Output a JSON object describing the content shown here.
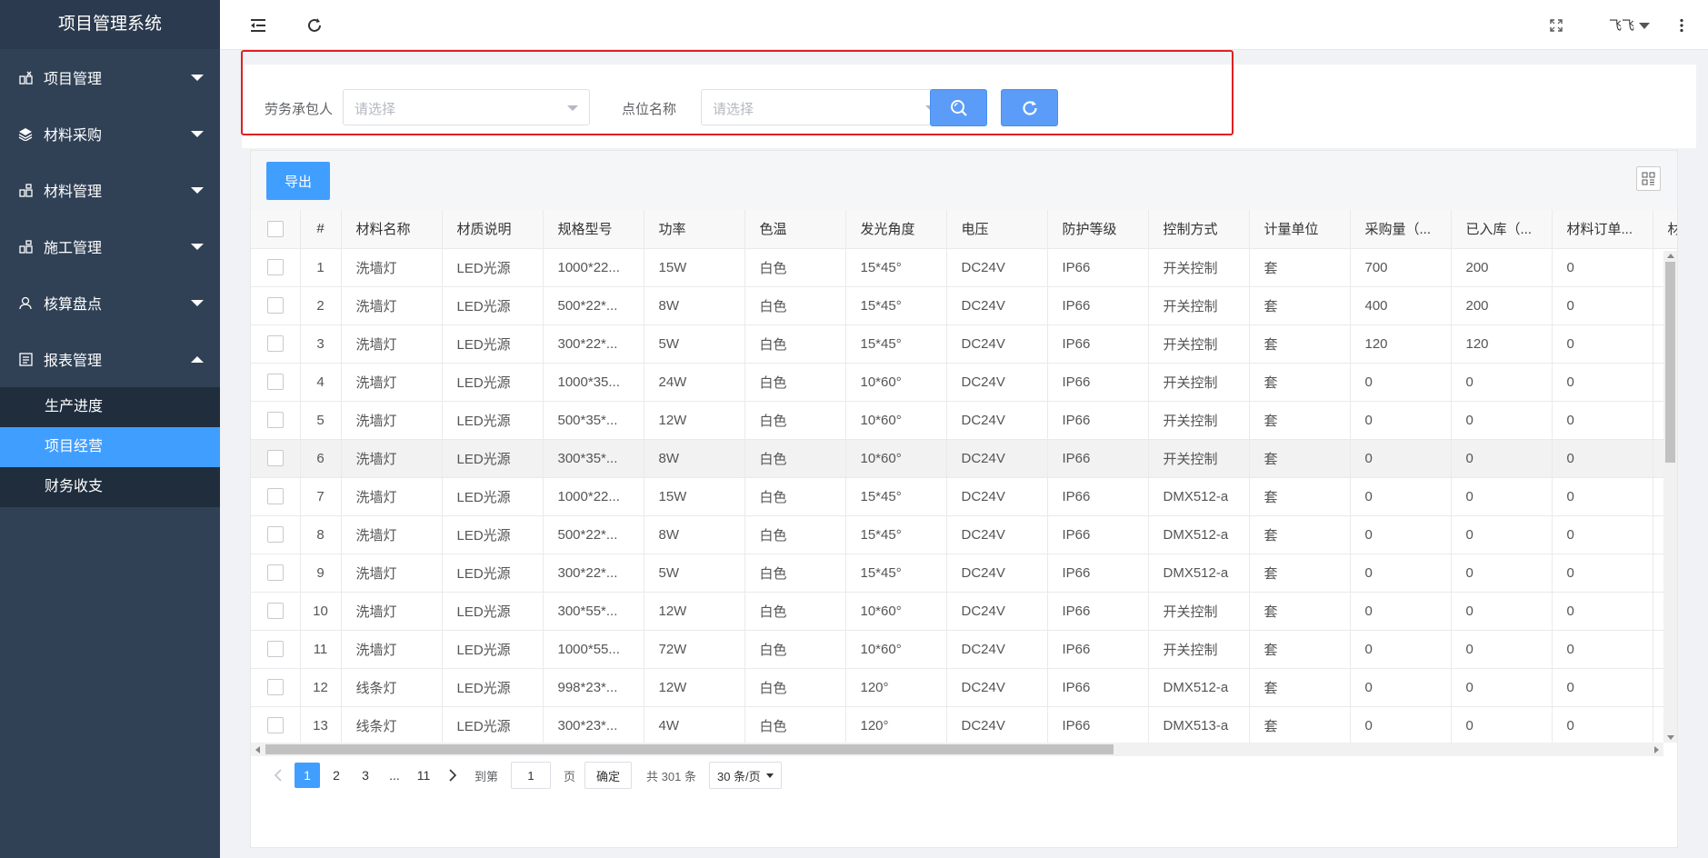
{
  "app": {
    "title": "项目管理系统"
  },
  "sidebar": {
    "menus": [
      {
        "label": "项目管理",
        "icon": "project-icon",
        "expanded": false
      },
      {
        "label": "材料采购",
        "icon": "layers-icon",
        "expanded": false
      },
      {
        "label": "材料管理",
        "icon": "grid-icon",
        "expanded": false
      },
      {
        "label": "施工管理",
        "icon": "grid-icon",
        "expanded": false
      },
      {
        "label": "核算盘点",
        "icon": "user-icon",
        "expanded": false
      },
      {
        "label": "报表管理",
        "icon": "report-icon",
        "expanded": true
      }
    ],
    "submenu": [
      {
        "label": "生产进度",
        "active": false
      },
      {
        "label": "项目经营",
        "active": true
      },
      {
        "label": "财务收支",
        "active": false
      }
    ]
  },
  "header": {
    "user": "飞飞",
    "icons": [
      "collapse-menu-icon",
      "refresh-icon",
      "fullscreen-icon",
      "more-icon"
    ]
  },
  "search": {
    "contractor_label": "劳务承包人",
    "contractor_placeholder": "请选择",
    "point_label": "点位名称",
    "point_placeholder": "请选择"
  },
  "toolbar": {
    "export_label": "导出"
  },
  "table": {
    "columns": [
      "#",
      "材料名称",
      "材质说明",
      "规格型号",
      "功率",
      "色温",
      "发光角度",
      "电压",
      "防护等级",
      "控制方式",
      "计量单位",
      "采购量（...",
      "已入库（...",
      "材料订单...",
      "材"
    ],
    "rows": [
      [
        "1",
        "洗墙灯",
        "LED光源",
        "1000*22...",
        "15W",
        "白色",
        "15*45°",
        "DC24V",
        "IP66",
        "开关控制",
        "套",
        "700",
        "200",
        "0"
      ],
      [
        "2",
        "洗墙灯",
        "LED光源",
        "500*22*...",
        "8W",
        "白色",
        "15*45°",
        "DC24V",
        "IP66",
        "开关控制",
        "套",
        "400",
        "200",
        "0"
      ],
      [
        "3",
        "洗墙灯",
        "LED光源",
        "300*22*...",
        "5W",
        "白色",
        "15*45°",
        "DC24V",
        "IP66",
        "开关控制",
        "套",
        "120",
        "120",
        "0"
      ],
      [
        "4",
        "洗墙灯",
        "LED光源",
        "1000*35...",
        "24W",
        "白色",
        "10*60°",
        "DC24V",
        "IP66",
        "开关控制",
        "套",
        "0",
        "0",
        "0"
      ],
      [
        "5",
        "洗墙灯",
        "LED光源",
        "500*35*...",
        "12W",
        "白色",
        "10*60°",
        "DC24V",
        "IP66",
        "开关控制",
        "套",
        "0",
        "0",
        "0"
      ],
      [
        "6",
        "洗墙灯",
        "LED光源",
        "300*35*...",
        "8W",
        "白色",
        "10*60°",
        "DC24V",
        "IP66",
        "开关控制",
        "套",
        "0",
        "0",
        "0"
      ],
      [
        "7",
        "洗墙灯",
        "LED光源",
        "1000*22...",
        "15W",
        "白色",
        "15*45°",
        "DC24V",
        "IP66",
        "DMX512-a",
        "套",
        "0",
        "0",
        "0"
      ],
      [
        "8",
        "洗墙灯",
        "LED光源",
        "500*22*...",
        "8W",
        "白色",
        "15*45°",
        "DC24V",
        "IP66",
        "DMX512-a",
        "套",
        "0",
        "0",
        "0"
      ],
      [
        "9",
        "洗墙灯",
        "LED光源",
        "300*22*...",
        "5W",
        "白色",
        "15*45°",
        "DC24V",
        "IP66",
        "DMX512-a",
        "套",
        "0",
        "0",
        "0"
      ],
      [
        "10",
        "洗墙灯",
        "LED光源",
        "300*55*...",
        "12W",
        "白色",
        "10*60°",
        "DC24V",
        "IP66",
        "开关控制",
        "套",
        "0",
        "0",
        "0"
      ],
      [
        "11",
        "洗墙灯",
        "LED光源",
        "1000*55...",
        "72W",
        "白色",
        "10*60°",
        "DC24V",
        "IP66",
        "开关控制",
        "套",
        "0",
        "0",
        "0"
      ],
      [
        "12",
        "线条灯",
        "LED光源",
        "998*23*...",
        "12W",
        "白色",
        "120°",
        "DC24V",
        "IP66",
        "DMX512-a",
        "套",
        "0",
        "0",
        "0"
      ],
      [
        "13",
        "线条灯",
        "LED光源",
        "300*23*...",
        "4W",
        "白色",
        "120°",
        "DC24V",
        "IP66",
        "DMX513-a",
        "套",
        "0",
        "0",
        "0"
      ]
    ],
    "hover_row": 6
  },
  "pagination": {
    "pages": [
      "1",
      "2",
      "3",
      "...",
      "11"
    ],
    "current": "1",
    "goto_prefix": "到第",
    "goto_value": "1",
    "goto_suffix": "页",
    "confirm_label": "确定",
    "total_text": "共 301 条",
    "page_size": "30 条/页"
  },
  "colors": {
    "sidebar_bg": "#304156",
    "primary": "#409eff",
    "highlight_border": "#e02020"
  }
}
